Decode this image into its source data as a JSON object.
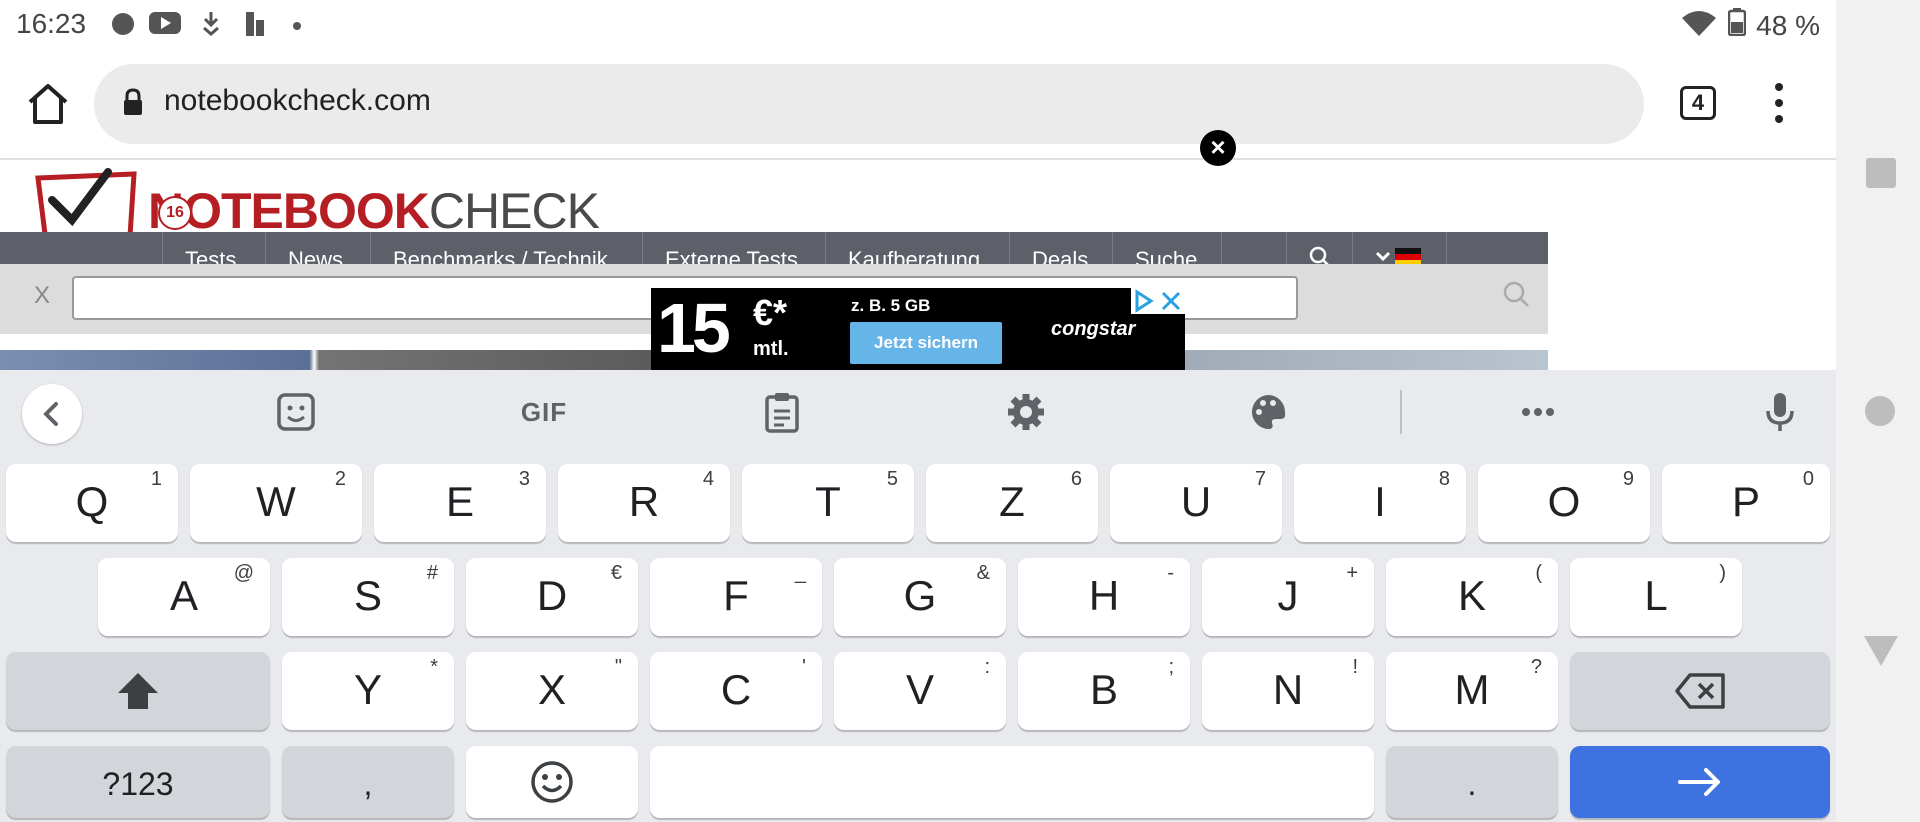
{
  "status_bar": {
    "time": "16:23",
    "icons": [
      "notification-icon",
      "youtube-icon",
      "download-icon",
      "sim-icon",
      "dot-icon"
    ],
    "battery_percent": "48 %"
  },
  "browser": {
    "url": "notebookcheck.com",
    "tab_count": "4"
  },
  "webpage": {
    "logo": {
      "part1": "NOTEBOOK",
      "part2": "CHECK",
      "badge": "16"
    },
    "nav": [
      "Tests",
      "News",
      "Benchmarks / Technik",
      "Externe Tests",
      "Kaufberatung",
      "Deals",
      "Suche",
      "..."
    ],
    "search_clear": "X",
    "ad": {
      "price": "15",
      "currency": "€*",
      "period": "mtl.",
      "offer": "z. B. 5 GB",
      "cta": "Jetzt sichern",
      "brand": "congstar"
    }
  },
  "keyboard": {
    "toolbar": [
      "back-icon",
      "sticker-icon",
      "GIF",
      "clipboard-icon",
      "settings-icon",
      "palette-icon",
      "more-icon",
      "mic-icon"
    ],
    "row1": [
      {
        "k": "Q",
        "h": "1"
      },
      {
        "k": "W",
        "h": "2"
      },
      {
        "k": "E",
        "h": "3"
      },
      {
        "k": "R",
        "h": "4"
      },
      {
        "k": "T",
        "h": "5"
      },
      {
        "k": "Z",
        "h": "6"
      },
      {
        "k": "U",
        "h": "7"
      },
      {
        "k": "I",
        "h": "8"
      },
      {
        "k": "O",
        "h": "9"
      },
      {
        "k": "P",
        "h": "0"
      }
    ],
    "row2": [
      {
        "k": "A",
        "h": "@"
      },
      {
        "k": "S",
        "h": "#"
      },
      {
        "k": "D",
        "h": "€"
      },
      {
        "k": "F",
        "h": "_"
      },
      {
        "k": "G",
        "h": "&"
      },
      {
        "k": "H",
        "h": "-"
      },
      {
        "k": "J",
        "h": "+"
      },
      {
        "k": "K",
        "h": "("
      },
      {
        "k": "L",
        "h": ")"
      }
    ],
    "row3": [
      {
        "k": "Y",
        "h": "*"
      },
      {
        "k": "X",
        "h": "\""
      },
      {
        "k": "C",
        "h": "'"
      },
      {
        "k": "V",
        "h": ":"
      },
      {
        "k": "B",
        "h": ";"
      },
      {
        "k": "N",
        "h": "!"
      },
      {
        "k": "M",
        "h": "?"
      }
    ],
    "symbols_label": "?123",
    "comma": ",",
    "period": "."
  },
  "colors": {
    "accent": "#3d72e0",
    "brand_red": "#b51f24",
    "nav_grey": "#5d6068"
  }
}
